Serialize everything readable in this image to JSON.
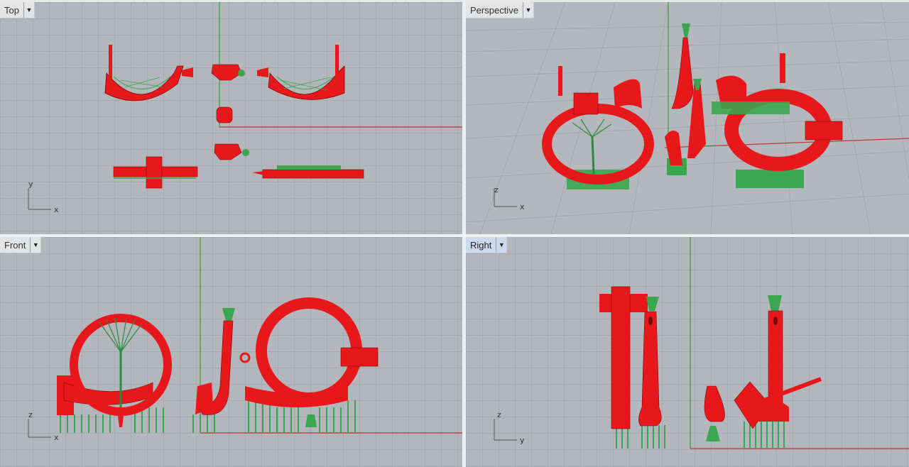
{
  "viewports": {
    "top": {
      "label": "Top",
      "axes": {
        "a": "y",
        "b": "x"
      }
    },
    "perspective": {
      "label": "Perspective",
      "axes": {
        "a": "z",
        "b": "x"
      }
    },
    "front": {
      "label": "Front",
      "axes": {
        "a": "z",
        "b": "x"
      }
    },
    "right": {
      "label": "Right",
      "axes": {
        "a": "z",
        "b": "y"
      }
    }
  },
  "active_viewport": "Right",
  "colors": {
    "model": "#e8171c",
    "model_shade": "#b80d10",
    "supports": "#3aa64f",
    "x_axis": "#b53a3a",
    "y_axis": "#3a9a3a",
    "grid_bg": "#b3b6ba"
  },
  "icons": {
    "dropdown": "chevron-down-icon"
  }
}
